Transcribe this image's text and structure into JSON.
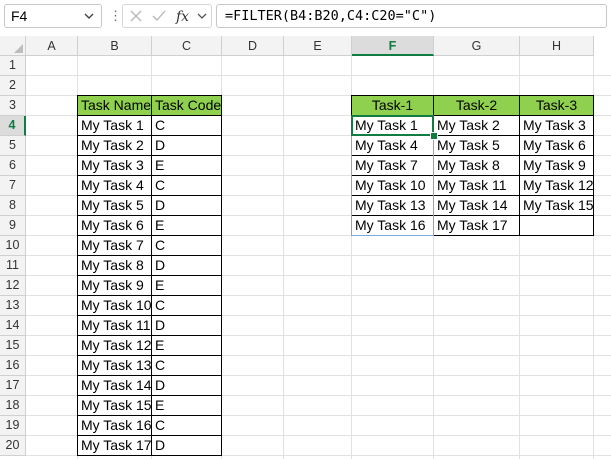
{
  "formula_bar": {
    "name_box": "F4",
    "formula": "=FILTER(B4:B20,C4:C20=\"C\")",
    "icons": [
      "chevron-down-icon",
      "cancel-icon",
      "enter-check-icon",
      "function-icon",
      "chevron-down-icon"
    ]
  },
  "columns": [
    "A",
    "B",
    "C",
    "D",
    "E",
    "F",
    "G",
    "H"
  ],
  "rows": [
    "1",
    "2",
    "3",
    "4",
    "5",
    "6",
    "7",
    "8",
    "9",
    "10",
    "11",
    "12",
    "13",
    "14",
    "15",
    "16",
    "17",
    "18",
    "19",
    "20"
  ],
  "selected_cell": {
    "column": "F",
    "row": "4"
  },
  "left_table": {
    "headers": [
      "Task Name",
      "Task Code"
    ],
    "header_color": "#8fd14f",
    "rows": [
      [
        "My Task 1",
        "C"
      ],
      [
        "My Task 2",
        "D"
      ],
      [
        "My Task 3",
        "E"
      ],
      [
        "My Task 4",
        "C"
      ],
      [
        "My Task 5",
        "D"
      ],
      [
        "My Task 6",
        "E"
      ],
      [
        "My Task 7",
        "C"
      ],
      [
        "My Task 8",
        "D"
      ],
      [
        "My Task 9",
        "E"
      ],
      [
        "My Task 10",
        "C"
      ],
      [
        "My Task 11",
        "D"
      ],
      [
        "My Task 12",
        "E"
      ],
      [
        "My Task 13",
        "C"
      ],
      [
        "My Task 14",
        "D"
      ],
      [
        "My Task 15",
        "E"
      ],
      [
        "My Task 16",
        "C"
      ],
      [
        "My Task 17",
        "D"
      ]
    ]
  },
  "right_table": {
    "headers": [
      "Task-1",
      "Task-2",
      "Task-3"
    ],
    "header_color": "#8fd14f",
    "rows": [
      [
        "My Task 1",
        "My Task 2",
        "My Task 3"
      ],
      [
        "My Task 4",
        "My Task 5",
        "My Task 6"
      ],
      [
        "My Task 7",
        "My Task 8",
        "My Task 9"
      ],
      [
        "My Task 10",
        "My Task 11",
        "My Task 12"
      ],
      [
        "My Task 13",
        "My Task 14",
        "My Task 15"
      ],
      [
        "My Task 16",
        "My Task 17",
        ""
      ]
    ]
  },
  "colors": {
    "accent": "#107c41",
    "spill_border": "#7ba7e0",
    "gridline": "#e1e1e1"
  }
}
